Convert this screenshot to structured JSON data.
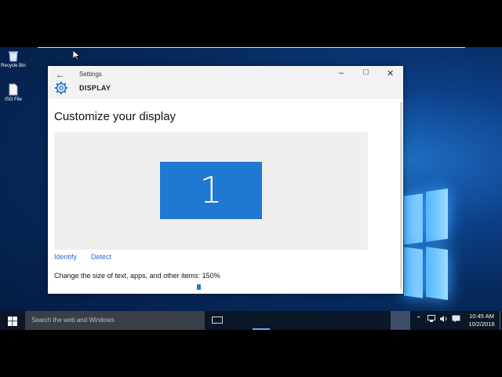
{
  "desktop": {
    "icons": [
      {
        "label": "Recycle Bin"
      },
      {
        "label": "ISO File"
      }
    ]
  },
  "window": {
    "title": "Settings",
    "section": "DISPLAY",
    "heading": "Customize your display",
    "monitor_number": "1",
    "identify_label": "Identify",
    "detect_label": "Detect",
    "scale_text": "Change the size of text, apps, and other items: 150%",
    "accent_color": "#1f78d1"
  },
  "taskbar": {
    "search_placeholder": "Search the web and Windows",
    "time": "10:45 AM",
    "date": "10/2/2016"
  }
}
